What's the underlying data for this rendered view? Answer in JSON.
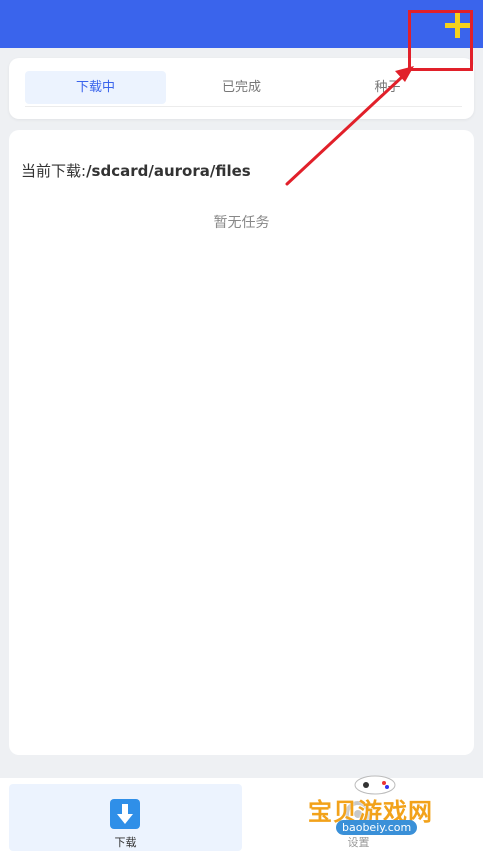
{
  "header": {
    "add_icon": "plus-icon",
    "accent_color": "#3a64ec",
    "add_icon_color": "#f5d21c"
  },
  "tabs": [
    {
      "label": "下载中",
      "active": true
    },
    {
      "label": "已完成",
      "active": false
    },
    {
      "label": "种子",
      "active": false
    }
  ],
  "content": {
    "path_label": "当前下载:",
    "path_value": "/sdcard/aurora/files",
    "empty_text": "暂无任务"
  },
  "bottom_nav": [
    {
      "label": "下载",
      "icon": "download-icon",
      "active": true
    },
    {
      "label": "设置",
      "icon": "settings-icon",
      "active": false
    }
  ],
  "annotation": {
    "highlight_color": "#e1202a"
  },
  "watermark": {
    "text": "宝贝游戏网",
    "url": "baobeiy.com"
  }
}
